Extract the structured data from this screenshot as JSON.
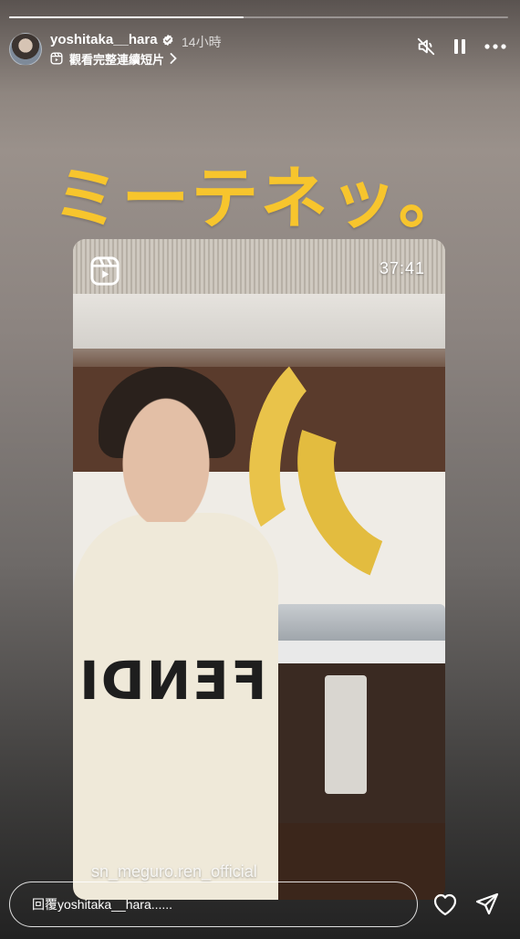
{
  "story": {
    "progress": 0.47,
    "username": "yoshitaka__hara",
    "time_ago": "14小時",
    "reel_link_label": "觀看完整連續短片"
  },
  "icons": {
    "avatar": "profile-avatar",
    "verified": "verified-badge-icon",
    "mute": "speaker-muted-icon",
    "pause": "pause-icon",
    "more": "more-options-icon",
    "reel": "reel-icon",
    "heart": "heart-icon",
    "send": "send-icon"
  },
  "content": {
    "headline": "ミーテネッ。",
    "video_duration": "37:41",
    "video_watermark": "sn_meguro.ren_official",
    "sweater_text": "FENDI"
  },
  "footer": {
    "reply_placeholder": "回覆yoshitaka__hara......"
  },
  "colors": {
    "headline": "#f7c52d",
    "text": "#ffffff"
  }
}
